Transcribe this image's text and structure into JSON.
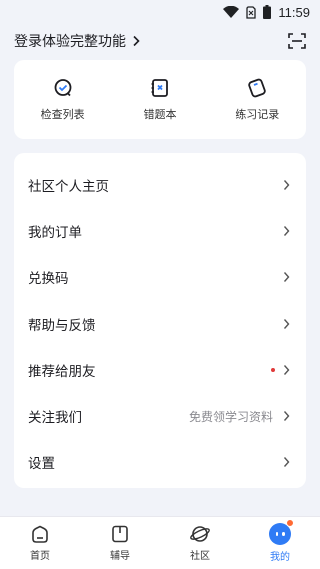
{
  "status_bar": {
    "time": "11:59",
    "icons": [
      "wifi-icon",
      "no-sim-icon",
      "battery-icon"
    ]
  },
  "header": {
    "login_text": "登录体验完整功能",
    "login_chevron_icon": "chevron-right-icon",
    "scan_icon": "scan-icon"
  },
  "quick_actions": [
    {
      "label": "检查列表",
      "icon": "checklist-icon"
    },
    {
      "label": "错题本",
      "icon": "mistake-book-icon"
    },
    {
      "label": "练习记录",
      "icon": "practice-record-icon"
    }
  ],
  "menu": [
    {
      "label": "社区个人主页"
    },
    {
      "label": "我的订单"
    },
    {
      "label": "兑换码"
    },
    {
      "label": "帮助与反馈"
    },
    {
      "label": "推荐给朋友",
      "has_dot": true
    },
    {
      "label": "关注我们",
      "hint": "免费领学习资料"
    },
    {
      "label": "设置"
    }
  ],
  "tabs": [
    {
      "label": "首页",
      "icon": "home-icon"
    },
    {
      "label": "辅导",
      "icon": "tutoring-icon"
    },
    {
      "label": "社区",
      "icon": "community-icon"
    },
    {
      "label": "我的",
      "icon": "profile-icon",
      "active": true
    }
  ],
  "colors": {
    "accent": "#2f7bf5",
    "background": "#f1f3f9",
    "dot": "#e03a3a",
    "badge": "#ff6a33"
  }
}
